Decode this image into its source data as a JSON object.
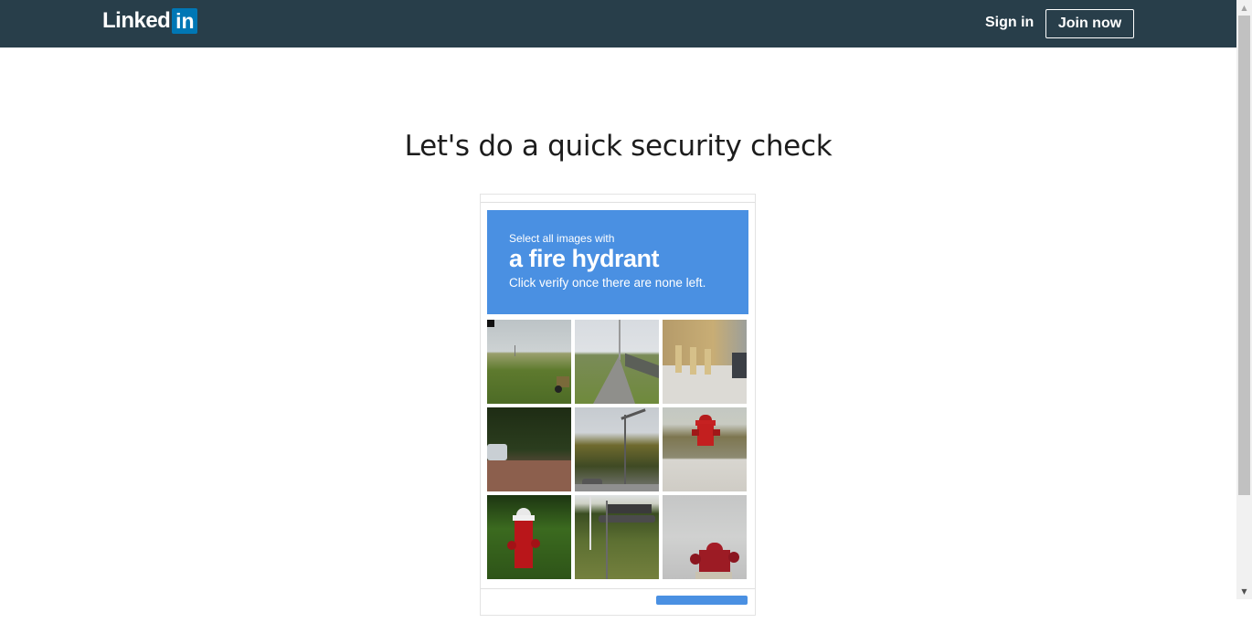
{
  "header": {
    "logo_text": "Linked",
    "logo_badge": "in",
    "sign_in": "Sign in",
    "join_now": "Join now"
  },
  "page": {
    "title": "Let's do a quick security check"
  },
  "captcha": {
    "instruction_small": "Select all images with",
    "target": "a fire hydrant",
    "hint": "Click verify once there are none left.",
    "accent_color": "#4a90e2",
    "tiles": [
      {
        "desc_icon": "field-tile"
      },
      {
        "desc_icon": "road-tile"
      },
      {
        "desc_icon": "building-tile"
      },
      {
        "desc_icon": "parked-car-tile"
      },
      {
        "desc_icon": "street-trees-tile"
      },
      {
        "desc_icon": "fire-hydrant-tile"
      },
      {
        "desc_icon": "fire-hydrant-tile"
      },
      {
        "desc_icon": "parking-lot-tile"
      },
      {
        "desc_icon": "fire-hydrant-tile"
      }
    ]
  },
  "colors": {
    "header_bg": "#283e4a",
    "logo_badge_bg": "#0077b5"
  }
}
